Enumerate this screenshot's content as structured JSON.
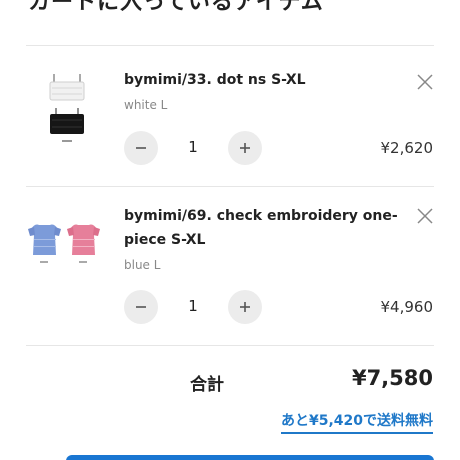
{
  "header": {
    "title": "カートに入っているアイテム"
  },
  "items": [
    {
      "name": "bymimi/33. dot ns S-XL",
      "variant": "white L",
      "quantity": "1",
      "price": "¥2,620",
      "thumb_icon": "camisole-tops-icon",
      "colors": [
        "#f2f2f2",
        "#1a1a1a"
      ]
    },
    {
      "name": "bymimi/69. check embroidery one-piece S-XL",
      "variant": "blue L",
      "quantity": "1",
      "price": "¥4,960",
      "thumb_icon": "dress-icon",
      "colors": [
        "#7c9bd9",
        "#e67f9a"
      ]
    }
  ],
  "summary": {
    "total_label": "合計",
    "total_value": "¥7,580",
    "free_shipping_link": "あと¥5,420で送料無料"
  },
  "colors": {
    "accent": "#1f78c8",
    "button": "#1976d2"
  }
}
